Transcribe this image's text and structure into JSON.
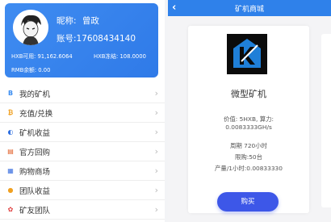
{
  "profile": {
    "nickname_label": "昵称:",
    "nickname": "曾政",
    "account_label": "账号:",
    "account": "17608434140",
    "hxb_available": "HXB可用: 91,162.6064",
    "hxb_frozen": "HXB冻结: 108.0000",
    "rmb_balance": "RMB余额: 0.00"
  },
  "menu": {
    "items": [
      {
        "label": "我的矿机",
        "icon": "B",
        "icon_name": "bitcoin-b-icon",
        "color": "#3a8cf0"
      },
      {
        "label": "充值/兑换",
        "icon": "₿",
        "icon_name": "bitcoin-coin-icon",
        "color": "#f0a020"
      },
      {
        "label": "矿机收益",
        "icon": "◐",
        "icon_name": "pie-chart-icon",
        "color": "#2f6fe0"
      },
      {
        "label": "官方回购",
        "icon": "▤",
        "icon_name": "buyback-icon",
        "color": "#e05a20"
      },
      {
        "label": "购物商场",
        "icon": "▦",
        "icon_name": "mall-icon",
        "color": "#3a6fe0"
      },
      {
        "label": "团队收益",
        "icon": "●",
        "icon_name": "team-earnings-icon",
        "color": "#f0a020"
      },
      {
        "label": "矿友团队",
        "icon": "✿",
        "icon_name": "team-icon",
        "color": "#e04040"
      }
    ]
  },
  "shop": {
    "title": "矿机商城",
    "product": {
      "name": "微型矿机",
      "price_line1": "价值: 5HXB, 算力:",
      "price_line2": "0.0083333GH/s",
      "period": "周期 720小时",
      "limit": "限购:50台",
      "output": "产量/1小时:0.00833330"
    },
    "buy_label": "购买"
  },
  "colors": {
    "brand_blue": "#2f81ea",
    "button_blue": "#3d57e8"
  }
}
